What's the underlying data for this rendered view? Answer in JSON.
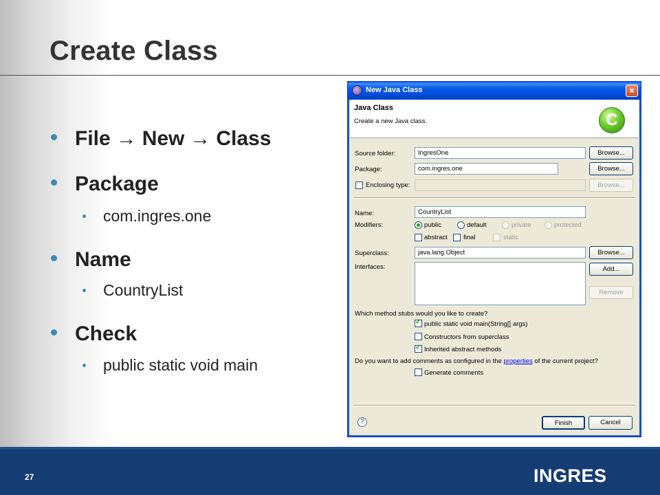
{
  "slide": {
    "title": "Create Class",
    "bullets": [
      {
        "parts": [
          "File",
          "New",
          "Class"
        ],
        "arrow": "→"
      },
      {
        "text": "Package"
      },
      {
        "text": "com.ingres.one"
      },
      {
        "text": "Name"
      },
      {
        "text": "CountryList"
      },
      {
        "text": "Check"
      },
      {
        "text": "public static void main"
      }
    ],
    "slide_number": "27",
    "logo_text": "INGRES",
    "colors": {
      "footer": "#163d73",
      "bullet": "#3e8ab0",
      "title": "#333333"
    }
  },
  "dialog": {
    "title": "New Java Class",
    "title_icon": "eclipse-icon",
    "header_title": "Java Class",
    "header_description": "Create a new Java class.",
    "header_icon": "class-wizard-icon",
    "header_icon_letter": "C",
    "source_folder": {
      "label": "Source folder:",
      "value": "IngresOne",
      "browse": "Browse..."
    },
    "package": {
      "label": "Package:",
      "value": "com.ingres.one",
      "browse": "Browse..."
    },
    "enclosing_type": {
      "label": "Enclosing type:",
      "value": "",
      "browse": "Browse...",
      "checked": false
    },
    "name": {
      "label": "Name:",
      "value": "CountryList"
    },
    "modifiers": {
      "label": "Modifiers:",
      "visibility": [
        "public",
        "default",
        "private",
        "protected"
      ],
      "selected": "public",
      "flags": [
        "abstract",
        "final",
        "static"
      ]
    },
    "superclass": {
      "label": "Superclass:",
      "value": "java.lang.Object",
      "browse": "Browse..."
    },
    "interfaces": {
      "label": "Interfaces:",
      "add": "Add...",
      "remove": "Remove"
    },
    "stubs": {
      "question": "Which method stubs would you like to create?",
      "options": [
        {
          "label": "public static void main(String[] args)",
          "checked": true
        },
        {
          "label": "Constructors from superclass",
          "checked": false
        },
        {
          "label": "Inherited abstract methods",
          "checked": true
        }
      ]
    },
    "comments": {
      "question_pre": "Do you want to add comments as configured in the ",
      "question_link": "properties",
      "question_post": " of the current project?",
      "option": "Generate comments",
      "checked": false
    },
    "buttons": {
      "finish": "Finish",
      "cancel": "Cancel",
      "help": "?",
      "close": "×"
    }
  }
}
